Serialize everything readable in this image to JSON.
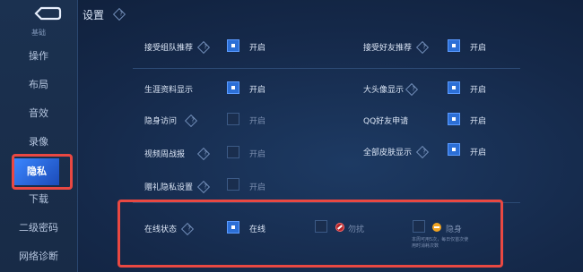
{
  "page": {
    "title": "设置"
  },
  "sidebar": {
    "partial_top": "基础",
    "items": [
      {
        "label": "操作"
      },
      {
        "label": "布局"
      },
      {
        "label": "音效"
      },
      {
        "label": "录像"
      },
      {
        "label": "隐私"
      },
      {
        "label": "下载"
      },
      {
        "label": "二级密码"
      },
      {
        "label": "网络诊断"
      }
    ],
    "active": "隐私"
  },
  "toggle_text": "开启",
  "left_settings": [
    {
      "label": "接受组队推荐",
      "help": true,
      "checked": true
    },
    {
      "label": "生涯资料显示",
      "help": false,
      "checked": true
    },
    {
      "label": "隐身访问",
      "help": true,
      "checked": false
    },
    {
      "label": "视频周战报",
      "help": true,
      "checked": false
    },
    {
      "label": "赠礼隐私设置",
      "help": true,
      "checked": false
    }
  ],
  "right_settings": [
    {
      "label": "接受好友推荐",
      "help": true,
      "checked": true
    },
    {
      "label": "大头像显示",
      "help": true,
      "checked": true
    },
    {
      "label": "QQ好友申请",
      "help": false,
      "checked": true
    },
    {
      "label": "全部皮肤显示",
      "help": true,
      "checked": true
    }
  ],
  "online_status": {
    "label": "在线状态",
    "options": [
      {
        "label": "在线",
        "checked": true,
        "icon": "none"
      },
      {
        "label": "勿扰",
        "checked": false,
        "icon": "do-not-disturb-icon"
      },
      {
        "label": "隐身",
        "checked": false,
        "icon": "invisible-icon"
      }
    ],
    "note_line1": "本周可用5次，每日仅首次使",
    "note_line2": "用时消耗次数"
  },
  "colors": {
    "accent": "#2c6fd6",
    "highlight_frame": "#e94842",
    "background": "#15294a"
  }
}
